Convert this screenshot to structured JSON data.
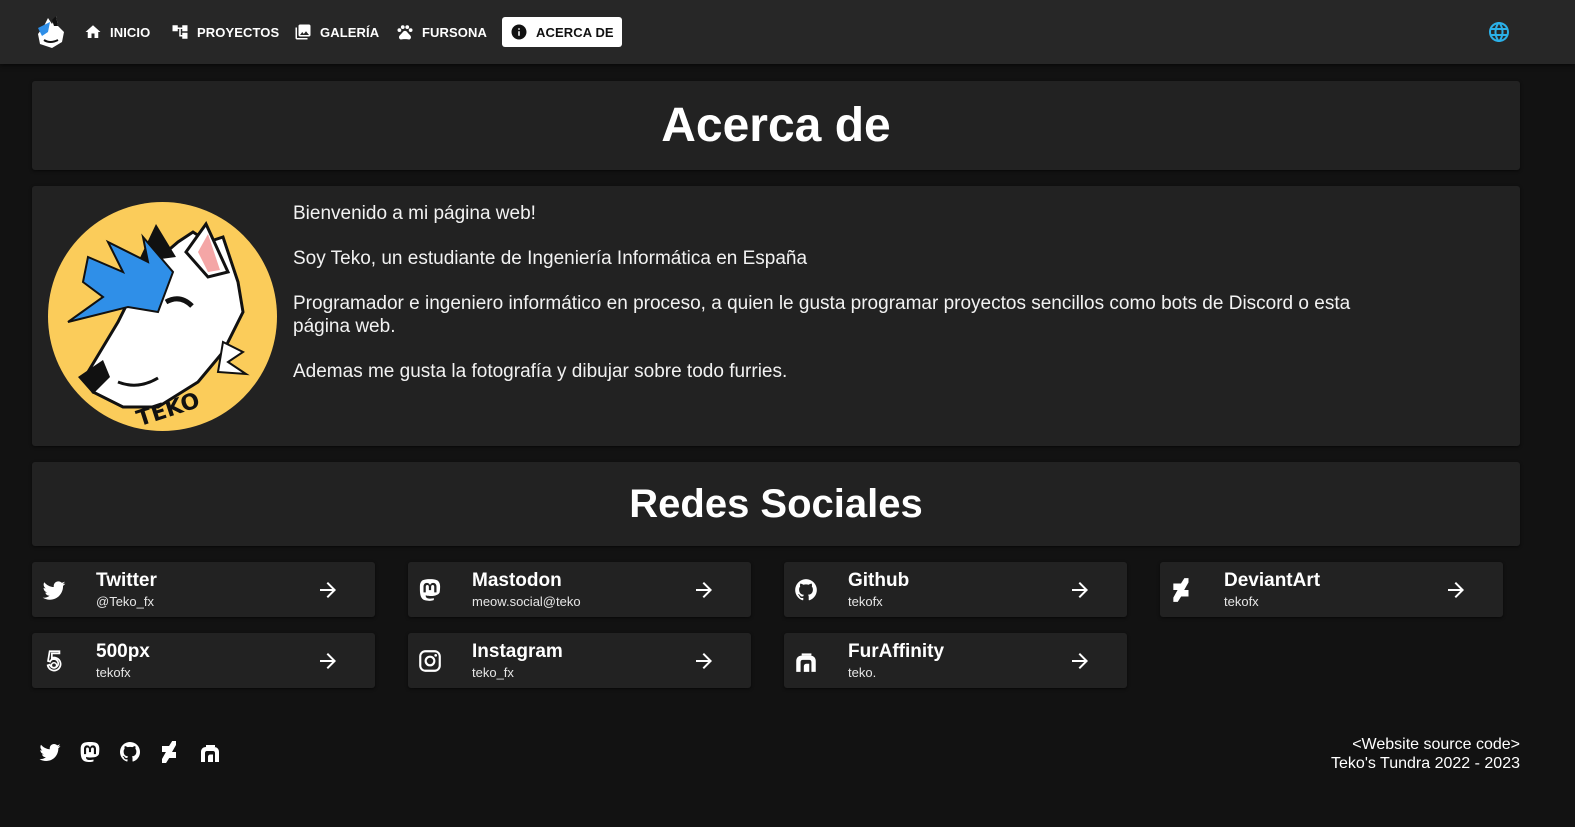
{
  "nav": {
    "items": [
      {
        "label": "INICIO",
        "icon": "home-icon"
      },
      {
        "label": "PROYECTOS",
        "icon": "projects-icon"
      },
      {
        "label": "GALERÍA",
        "icon": "gallery-icon"
      },
      {
        "label": "FURSONA",
        "icon": "paw-icon"
      },
      {
        "label": "ACERCA DE",
        "icon": "info-icon",
        "active": true
      }
    ],
    "language_icon": "globe-icon",
    "globe_color": "#2bb0e8"
  },
  "about": {
    "title": "Acerca de",
    "paragraphs": [
      "Bienvenido a mi página web!",
      "Soy Teko, un estudiante de Ingeniería Informática en España",
      "Programador e ingeniero informático en proceso, a quien le gusta programar proyectos sencillos como bots de Discord o esta página web.",
      "Ademas me gusta la fotografía y dibujar sobre todo furries."
    ],
    "avatar_text": "TEKO"
  },
  "social": {
    "title": "Redes Sociales",
    "items": [
      {
        "name": "Twitter",
        "handle": "@Teko_fx",
        "icon": "twitter-icon"
      },
      {
        "name": "Mastodon",
        "handle": "meow.social@teko",
        "icon": "mastodon-icon"
      },
      {
        "name": "Github",
        "handle": "tekofx",
        "icon": "github-icon"
      },
      {
        "name": "DeviantArt",
        "handle": "tekofx",
        "icon": "deviantart-icon"
      },
      {
        "name": "500px",
        "handle": "tekofx",
        "icon": "500px-icon"
      },
      {
        "name": "Instagram",
        "handle": "teko_fx",
        "icon": "instagram-icon"
      },
      {
        "name": "FurAffinity",
        "handle": "teko.",
        "icon": "furaffinity-icon"
      }
    ]
  },
  "footer": {
    "source_link": "<Website source code>",
    "copyright": "Teko's Tundra 2022 - 2023",
    "icons": [
      "twitter-icon",
      "mastodon-icon",
      "github-icon",
      "deviantart-icon",
      "furaffinity-icon"
    ]
  },
  "colors": {
    "background": "#121212",
    "card": "#222222",
    "navbar": "#272727",
    "avatar_bg": "#fbcc5a",
    "accent_blue": "#2bb0e8"
  }
}
